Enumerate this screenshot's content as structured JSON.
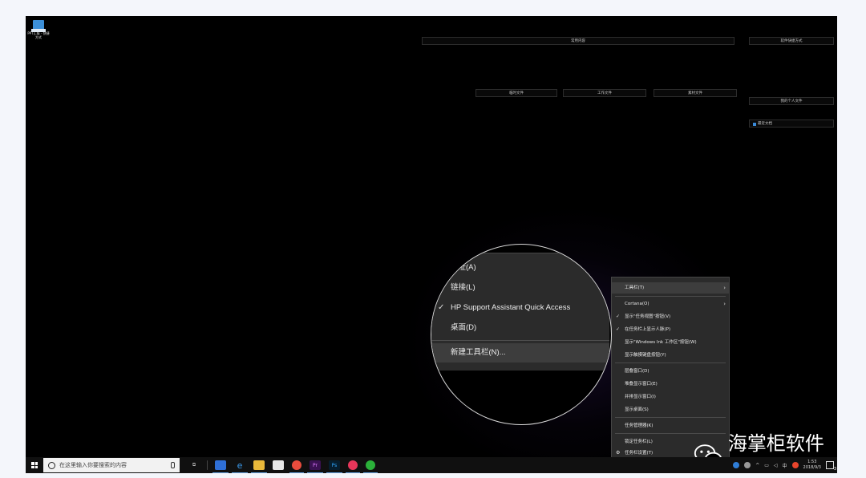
{
  "desktop": {
    "icon_label": "PPT汇报 - 快捷方式",
    "fences": {
      "common": "常用内容",
      "software": "软件快捷方式",
      "temp": "临时文件",
      "work": "工作文件",
      "material": "素材文件",
      "personal": "我的个人文件",
      "recent": "最近文档"
    }
  },
  "magnifier": {
    "items": [
      {
        "label": "地址(A)",
        "checked": false
      },
      {
        "label": "链接(L)",
        "checked": false
      },
      {
        "label": "HP Support Assistant Quick Access",
        "checked": true
      },
      {
        "label": "桌面(D)",
        "checked": false
      },
      {
        "label": "新建工具栏(N)...",
        "checked": false
      }
    ]
  },
  "context_menu": {
    "toolbars": "工具栏(T)",
    "cortana": "Cortana(O)",
    "show_task_view": "显示\"任务视图\"按钮(V)",
    "show_people": "在任务栏上显示人脉(P)",
    "show_ink": "显示\"Windows Ink 工作区\"按钮(W)",
    "show_keyboard": "显示触摸键盘按钮(Y)",
    "cascade": "层叠窗口(D)",
    "stacked": "堆叠显示窗口(E)",
    "side_by_side": "并排显示窗口(I)",
    "show_desktop": "显示桌面(S)",
    "task_manager": "任务管理器(K)",
    "lock_taskbar": "锁定任务栏(L)",
    "taskbar_settings": "任务栏设置(T)",
    "check_mark": "✓",
    "arrow": "›"
  },
  "taskbar": {
    "search_placeholder": "在这里输入你要搜索的内容",
    "time": "1:53",
    "date": "2018/9/3",
    "ime": "中",
    "notification_count": "3"
  },
  "watermark": {
    "text": "海掌柜软件库"
  },
  "colors": {
    "menu_bg": "#2b2b2b",
    "menu_highlight": "#3d3d3d",
    "taskbar_bg": "#101010",
    "accent_blue": "#3c8fd8"
  }
}
